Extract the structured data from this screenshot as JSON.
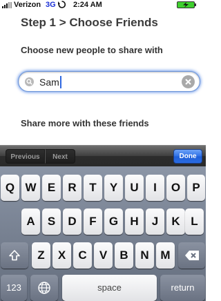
{
  "status_bar": {
    "carrier": "Verizon",
    "network": "3G",
    "time": "2:24 AM",
    "signal_icon": "signal-bars-icon",
    "activity_icon": "sync-activity-icon",
    "battery_icon": "battery-charging-icon"
  },
  "page": {
    "title": "Step 1 > Choose Friends",
    "choose_label": "Choose new people to share with",
    "share_more_label": "Share more with these friends"
  },
  "search": {
    "value": "Sam",
    "icon": "search-icon",
    "clear_icon": "clear-icon"
  },
  "toolbar": {
    "previous_label": "Previous",
    "next_label": "Next",
    "done_label": "Done"
  },
  "keyboard": {
    "row1": [
      "Q",
      "W",
      "E",
      "R",
      "T",
      "Y",
      "U",
      "I",
      "O",
      "P"
    ],
    "row2": [
      "A",
      "S",
      "D",
      "F",
      "G",
      "H",
      "J",
      "K",
      "L"
    ],
    "row3": [
      "Z",
      "X",
      "C",
      "V",
      "B",
      "N",
      "M"
    ],
    "numbers_label": "123",
    "space_label": "space",
    "return_label": "return",
    "shift_icon": "shift-icon",
    "globe_icon": "globe-icon",
    "backspace_icon": "backspace-icon"
  },
  "colors": {
    "accent": "#2d6fe6",
    "focus_glow": "#6a93d8",
    "network_text": "#1a2fd6"
  }
}
